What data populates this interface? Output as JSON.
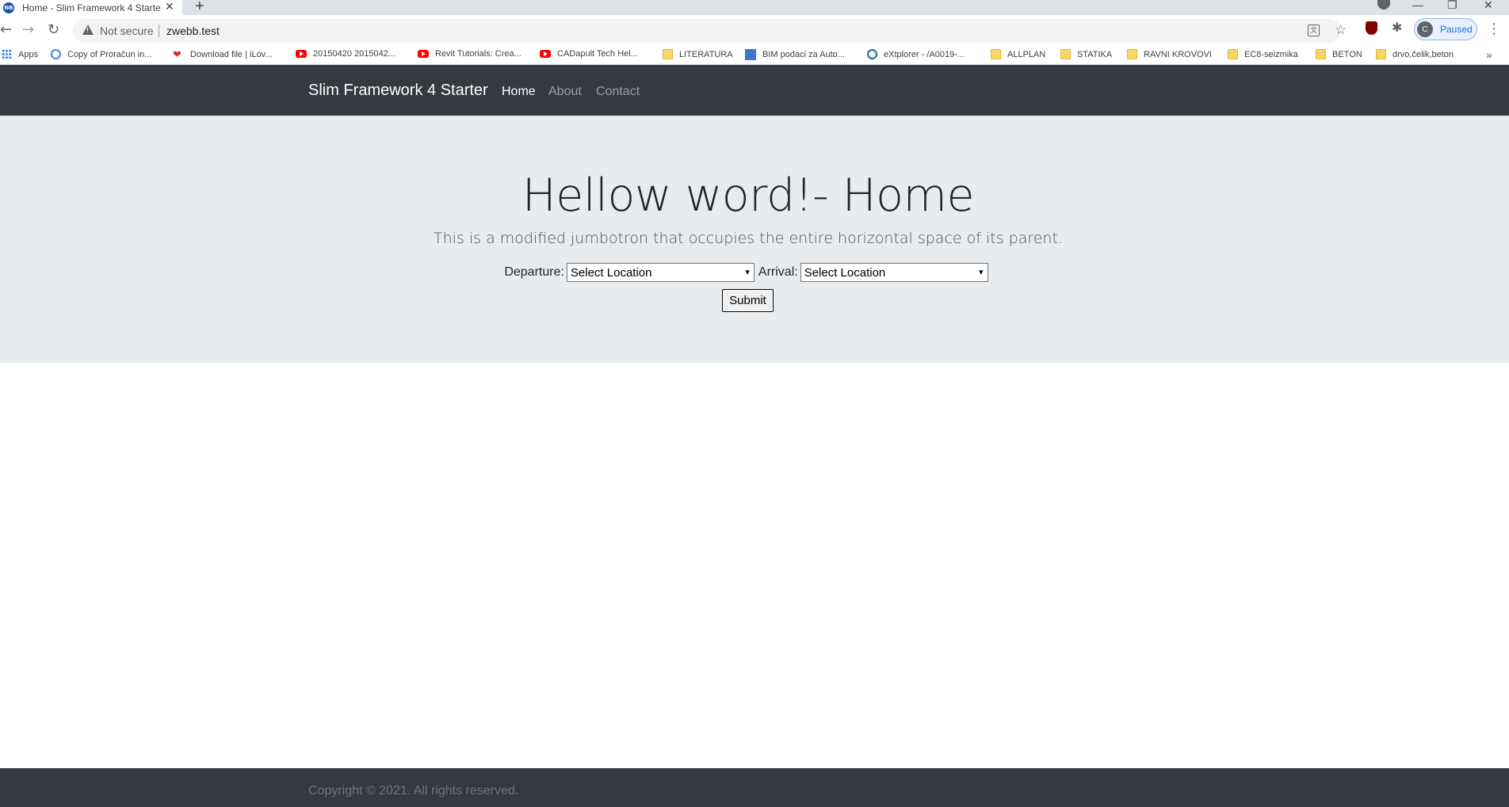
{
  "browser": {
    "tab_title": "Home - Slim Framework 4 Starter",
    "tab_favicon_text": "NB",
    "tab_close": "✕",
    "new_tab": "+",
    "window_controls": {
      "minimize": "—",
      "restore": "❐",
      "close": "✕"
    },
    "omnibox": {
      "security_label": "Not secure",
      "url": "zwebb.test"
    },
    "translate_glyph": "文",
    "star_glyph": "☆",
    "puzzle_glyph": "✱",
    "profile": {
      "initial": "C",
      "status": "Paused"
    },
    "menu_glyph": "⋮",
    "back_glyph": "←",
    "forward_glyph": "→",
    "reload_glyph": "↻",
    "bookmarks": [
      {
        "label": "Apps",
        "icon": "apps-grid-icon"
      },
      {
        "label": "Copy of Proračun in...",
        "icon": "fingerprint-icon"
      },
      {
        "label": "Download file | iLov...",
        "icon": "heart-icon"
      },
      {
        "label": "20150420 2015042...",
        "icon": "youtube-icon"
      },
      {
        "label": "Revit Tutorials: Crea...",
        "icon": "youtube-icon"
      },
      {
        "label": "CADapult Tech Hel...",
        "icon": "youtube-icon"
      },
      {
        "label": "LITERATURA",
        "icon": "folder-icon"
      },
      {
        "label": "BIM podaci za Auto...",
        "icon": "bim-icon"
      },
      {
        "label": "eXtplorer - /A0019-...",
        "icon": "globe-icon"
      },
      {
        "label": "ALLPLAN",
        "icon": "folder-icon"
      },
      {
        "label": "STATIKA",
        "icon": "folder-icon"
      },
      {
        "label": "RAVNI KROVOVI",
        "icon": "folder-icon"
      },
      {
        "label": "EC8-seizmika",
        "icon": "folder-icon"
      },
      {
        "label": "BETON",
        "icon": "folder-icon"
      },
      {
        "label": "drvo,čelik,beton",
        "icon": "folder-icon"
      }
    ],
    "bookmarks_more": "»"
  },
  "navbar": {
    "brand": "Slim Framework 4 Starter",
    "links": [
      {
        "label": "Home",
        "active": true
      },
      {
        "label": "About",
        "active": false
      },
      {
        "label": "Contact",
        "active": false
      }
    ]
  },
  "jumbotron": {
    "title": "Hellow word!- Home",
    "lead": "This is a modified jumbotron that occupies the entire horizontal space of its parent.",
    "form": {
      "departure_label": "Departure:",
      "departure_value": "Select Location",
      "arrival_label": "Arrival:",
      "arrival_value": "Select Location",
      "submit_label": "Submit",
      "chevron": "⌄"
    }
  },
  "footer": {
    "text": "Copyright © 2021. All rights reserved."
  }
}
